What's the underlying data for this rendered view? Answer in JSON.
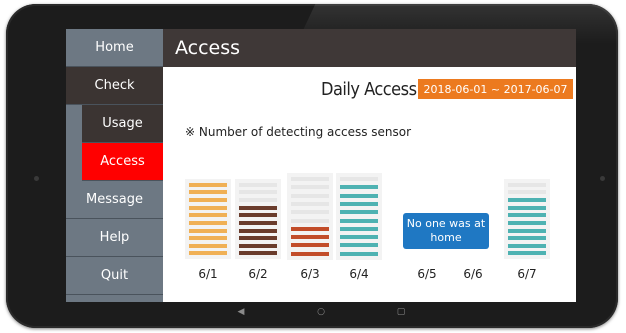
{
  "sidebar": {
    "items": [
      {
        "label": "Home"
      },
      {
        "label": "Check"
      },
      {
        "label": "Usage"
      },
      {
        "label": "Access"
      },
      {
        "label": "Message"
      },
      {
        "label": "Help"
      },
      {
        "label": "Quit"
      }
    ],
    "active": "Access"
  },
  "header": {
    "title": "Access"
  },
  "content": {
    "heading": "Daily Access",
    "date_range": "2018-06-01 ~ 2017-06-07",
    "note": "※ Number of detecting access sensor",
    "no_data_message": "No one was at home"
  },
  "colors": {
    "accent": "#ec7a1f",
    "active_menu": "#ff0000",
    "info": "#1f78c3"
  },
  "chart_data": {
    "type": "bar",
    "categories": [
      "6/1",
      "6/2",
      "6/3",
      "6/4",
      "6/5",
      "6/6",
      "6/7"
    ],
    "values": [
      10,
      7,
      4,
      9,
      0,
      0,
      8
    ],
    "max": 10,
    "colors": [
      "#f0b055",
      "#6a3c2c",
      "#c24d2a",
      "#4eb2b2",
      "",
      "",
      "#4eb2b2"
    ]
  },
  "navigation": {
    "back_icon": "back-icon",
    "home_icon": "home-icon",
    "recent_icon": "recent-icon"
  }
}
